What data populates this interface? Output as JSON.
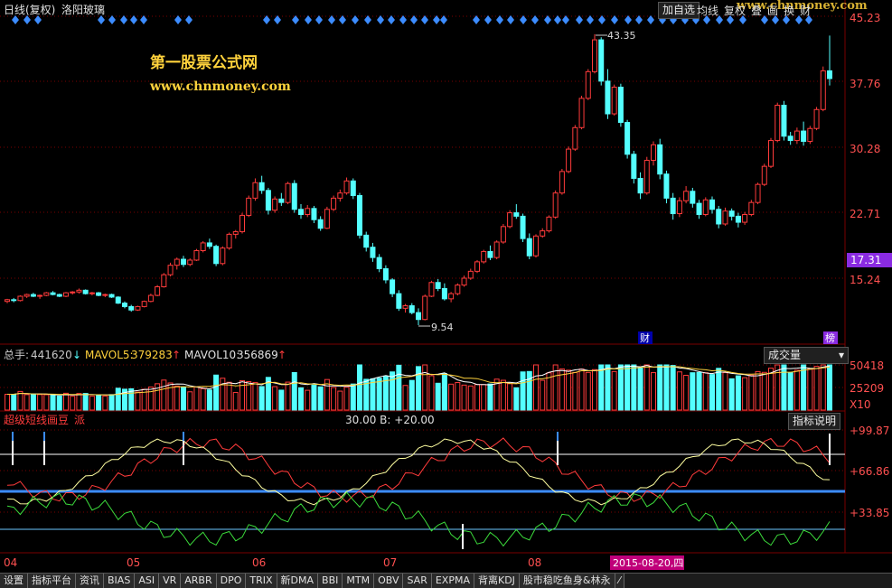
{
  "window": {
    "period_label": "日线(复权)",
    "stock_name": "洛阳玻璃",
    "add_watch_label": "加自选",
    "top_menu": [
      "均线",
      "复权",
      "叠",
      "画",
      "换",
      "财"
    ],
    "watermark": "www.chnmoney.com"
  },
  "banner": {
    "title": "第一股票公式网",
    "url": "www.chnmoney.com"
  },
  "price_axis": {
    "ticks": [
      "45.23",
      "37.76",
      "30.28",
      "22.71",
      "15.24"
    ],
    "current_price": "17.31",
    "high_label": "43.35",
    "low_label": "9.54",
    "cai_marker": "财",
    "bang_marker": "榜"
  },
  "volume_panel": {
    "total_label": "总手:",
    "total_value": "441620",
    "mavol5_label": "MAVOL5:",
    "mavol5_value": "379283",
    "mavol10_label": "MAVOL10:",
    "mavol10_value": "356869",
    "dropdown_label": "成交量",
    "axis_ticks": [
      "50418",
      "25209",
      "X10"
    ]
  },
  "indicator_panel": {
    "name": "超级短线画豆",
    "name_suffix": "派",
    "params_text": "30.00 B: +20.00",
    "help_label": "指标说明",
    "axis_ticks": [
      "+99.87",
      "+66.86",
      "+33.85"
    ]
  },
  "x_axis": {
    "month_labels": [
      "04",
      "05",
      "06",
      "07",
      "08"
    ],
    "cursor_date": "2015-08-20,四"
  },
  "bottom_tabs": [
    "设置",
    "指标平台",
    "资讯",
    "BIAS",
    "ASI",
    "VR",
    "ARBR",
    "DPO",
    "TRIX",
    "新DMA",
    "BBI",
    "MTM",
    "OBV",
    "SAR",
    "EXPMA",
    "背离KDJ",
    "股市稳吃鱼身&林永",
    "⁄"
  ],
  "colors": {
    "up": "#ff3b3b",
    "down": "#54ffff",
    "grid": "#7a0000",
    "axis_text": "#ff5050",
    "diamond": "#3c8cff",
    "blue_line": "#3c8cff",
    "yellow": "#ffd23c",
    "white": "#ffffff",
    "green": "#3cdc3c"
  },
  "chart_data": {
    "type": "candlestick",
    "price_ylim": [
      9.54,
      45.23
    ],
    "candles": [
      [
        12.3,
        12.6,
        12.1,
        12.5
      ],
      [
        12.5,
        12.7,
        12.2,
        12.4
      ],
      [
        12.4,
        13.0,
        12.3,
        12.9
      ],
      [
        12.9,
        13.2,
        12.7,
        13.1
      ],
      [
        13.1,
        13.3,
        12.8,
        12.9
      ],
      [
        12.9,
        13.1,
        12.6,
        13.0
      ],
      [
        13.0,
        13.4,
        12.9,
        13.3
      ],
      [
        13.3,
        13.5,
        13.0,
        13.1
      ],
      [
        13.1,
        13.2,
        12.8,
        12.9
      ],
      [
        12.9,
        13.4,
        12.8,
        13.3
      ],
      [
        13.3,
        13.5,
        13.1,
        13.4
      ],
      [
        13.4,
        13.8,
        13.2,
        13.6
      ],
      [
        13.6,
        13.7,
        13.1,
        13.2
      ],
      [
        13.2,
        13.4,
        13.0,
        13.3
      ],
      [
        13.3,
        13.4,
        12.9,
        13.0
      ],
      [
        13.0,
        13.2,
        12.8,
        13.1
      ],
      [
        13.1,
        13.2,
        12.7,
        12.8
      ],
      [
        12.8,
        12.9,
        12.0,
        12.1
      ],
      [
        12.1,
        12.3,
        11.5,
        11.7
      ],
      [
        11.7,
        11.9,
        11.1,
        11.3
      ],
      [
        11.3,
        11.8,
        11.2,
        11.7
      ],
      [
        11.7,
        12.4,
        11.6,
        12.3
      ],
      [
        12.3,
        13.2,
        12.2,
        13.0
      ],
      [
        13.0,
        14.2,
        12.9,
        14.0
      ],
      [
        14.0,
        15.6,
        13.9,
        15.4
      ],
      [
        15.4,
        16.8,
        15.2,
        16.5
      ],
      [
        16.5,
        17.4,
        16.0,
        17.2
      ],
      [
        17.2,
        17.6,
        16.3,
        16.6
      ],
      [
        16.6,
        17.3,
        16.4,
        17.1
      ],
      [
        17.1,
        18.4,
        17.0,
        18.2
      ],
      [
        18.2,
        19.3,
        18.0,
        19.1
      ],
      [
        19.1,
        19.6,
        18.4,
        18.7
      ],
      [
        18.7,
        18.9,
        16.4,
        16.7
      ],
      [
        16.7,
        18.7,
        16.5,
        18.5
      ],
      [
        18.5,
        20.3,
        18.3,
        20.1
      ],
      [
        20.1,
        20.6,
        19.6,
        20.4
      ],
      [
        20.4,
        22.6,
        20.2,
        22.3
      ],
      [
        22.3,
        24.6,
        22.1,
        24.3
      ],
      [
        24.3,
        26.6,
        24.0,
        26.1
      ],
      [
        26.1,
        26.9,
        24.8,
        25.2
      ],
      [
        25.2,
        25.5,
        22.4,
        22.9
      ],
      [
        22.9,
        24.5,
        22.6,
        24.2
      ],
      [
        24.2,
        24.9,
        23.4,
        23.8
      ],
      [
        23.8,
        26.2,
        23.6,
        26.0
      ],
      [
        26.0,
        26.4,
        22.6,
        23.0
      ],
      [
        23.0,
        23.6,
        21.9,
        22.4
      ],
      [
        22.4,
        23.5,
        22.1,
        23.1
      ],
      [
        23.1,
        23.4,
        21.4,
        21.8
      ],
      [
        21.8,
        22.2,
        20.5,
        20.8
      ],
      [
        20.8,
        23.3,
        20.7,
        23.0
      ],
      [
        23.0,
        24.6,
        22.8,
        24.3
      ],
      [
        24.3,
        25.3,
        23.9,
        24.9
      ],
      [
        24.9,
        26.7,
        24.7,
        26.3
      ],
      [
        26.3,
        26.6,
        24.2,
        24.6
      ],
      [
        24.6,
        24.9,
        19.6,
        20.0
      ],
      [
        20.0,
        20.4,
        18.1,
        18.6
      ],
      [
        18.6,
        19.1,
        16.9,
        17.4
      ],
      [
        17.4,
        17.8,
        15.7,
        16.1
      ],
      [
        16.1,
        16.5,
        14.4,
        14.8
      ],
      [
        14.8,
        15.0,
        12.8,
        13.2
      ],
      [
        13.2,
        13.6,
        11.2,
        11.5
      ],
      [
        11.5,
        12.0,
        11.0,
        11.8
      ],
      [
        11.8,
        12.1,
        10.8,
        11.0
      ],
      [
        11.0,
        11.5,
        9.54,
        10.2
      ],
      [
        10.2,
        13.1,
        10.1,
        12.9
      ],
      [
        12.9,
        14.7,
        12.8,
        14.5
      ],
      [
        14.5,
        14.9,
        13.5,
        13.8
      ],
      [
        13.8,
        14.4,
        12.4,
        12.6
      ],
      [
        12.6,
        13.4,
        12.2,
        13.2
      ],
      [
        13.2,
        14.4,
        13.0,
        14.2
      ],
      [
        14.2,
        15.3,
        14.0,
        15.0
      ],
      [
        15.0,
        16.1,
        14.8,
        15.8
      ],
      [
        15.8,
        17.1,
        15.6,
        16.9
      ],
      [
        16.9,
        18.3,
        16.7,
        18.1
      ],
      [
        18.1,
        18.8,
        17.1,
        17.4
      ],
      [
        17.4,
        19.4,
        17.2,
        19.2
      ],
      [
        19.2,
        21.3,
        19.0,
        21.0
      ],
      [
        21.0,
        22.9,
        20.8,
        22.6
      ],
      [
        22.6,
        23.6,
        21.9,
        22.2
      ],
      [
        22.2,
        22.5,
        19.2,
        19.6
      ],
      [
        19.6,
        20.2,
        17.2,
        17.6
      ],
      [
        17.6,
        20.1,
        17.4,
        19.9
      ],
      [
        19.9,
        20.8,
        19.7,
        20.5
      ],
      [
        20.5,
        22.3,
        20.3,
        22.1
      ],
      [
        22.1,
        25.2,
        21.9,
        24.9
      ],
      [
        24.9,
        27.7,
        24.7,
        27.4
      ],
      [
        27.4,
        30.3,
        27.2,
        30.0
      ],
      [
        30.0,
        32.8,
        29.8,
        32.5
      ],
      [
        32.5,
        36.2,
        32.3,
        35.9
      ],
      [
        35.9,
        39.3,
        35.7,
        39.0
      ],
      [
        39.0,
        43.35,
        38.8,
        42.7
      ],
      [
        42.7,
        43.0,
        37.4,
        37.9
      ],
      [
        37.9,
        39.3,
        33.5,
        34.1
      ],
      [
        34.1,
        37.5,
        33.9,
        37.2
      ],
      [
        37.2,
        37.6,
        32.6,
        33.1
      ],
      [
        33.1,
        33.4,
        28.9,
        29.4
      ],
      [
        29.4,
        29.8,
        26.0,
        26.6
      ],
      [
        26.6,
        27.3,
        24.2,
        24.9
      ],
      [
        24.9,
        29.1,
        24.7,
        28.7
      ],
      [
        28.7,
        30.9,
        28.1,
        30.5
      ],
      [
        30.5,
        31.2,
        26.5,
        27.1
      ],
      [
        27.1,
        27.5,
        23.7,
        24.3
      ],
      [
        24.3,
        24.9,
        21.8,
        22.5
      ],
      [
        22.5,
        24.4,
        22.1,
        24.0
      ],
      [
        24.0,
        25.7,
        23.7,
        25.1
      ],
      [
        25.1,
        25.5,
        23.2,
        23.7
      ],
      [
        23.7,
        24.1,
        21.9,
        22.4
      ],
      [
        22.4,
        24.4,
        22.2,
        24.1
      ],
      [
        24.1,
        24.5,
        22.5,
        23.0
      ],
      [
        23.0,
        23.4,
        20.8,
        21.3
      ],
      [
        21.3,
        23.2,
        21.1,
        22.8
      ],
      [
        22.8,
        23.1,
        21.7,
        22.2
      ],
      [
        22.2,
        22.6,
        20.9,
        21.5
      ],
      [
        21.5,
        22.7,
        21.2,
        22.4
      ],
      [
        22.4,
        24.1,
        22.2,
        23.8
      ],
      [
        23.8,
        26.1,
        23.6,
        25.9
      ],
      [
        25.9,
        28.3,
        25.7,
        28.0
      ],
      [
        28.0,
        31.3,
        27.8,
        31.0
      ],
      [
        31.0,
        35.4,
        30.8,
        35.1
      ],
      [
        35.1,
        35.6,
        31.0,
        31.5
      ],
      [
        31.5,
        32.0,
        30.5,
        31.0
      ],
      [
        31.0,
        32.5,
        30.6,
        32.1
      ],
      [
        32.1,
        33.2,
        30.4,
        30.9
      ],
      [
        30.9,
        32.7,
        30.6,
        32.4
      ],
      [
        32.4,
        34.9,
        32.2,
        34.6
      ],
      [
        34.6,
        39.6,
        34.4,
        39.1
      ],
      [
        39.1,
        43.2,
        37.4,
        38.2
      ]
    ],
    "volume_ylim": [
      0,
      50418
    ],
    "volume_panel_unit": "X10"
  }
}
